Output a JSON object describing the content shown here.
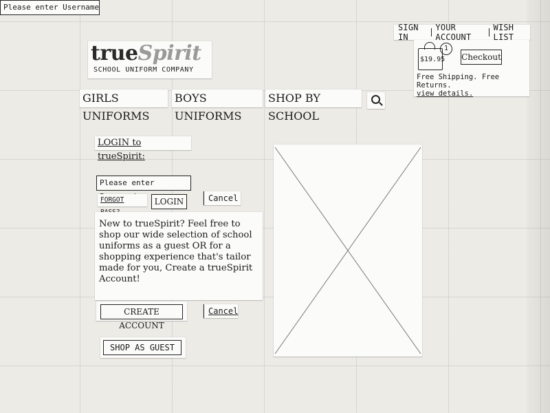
{
  "header": {
    "links": [
      "SIGN IN",
      "YOUR ACCOUNT",
      "WISH LIST"
    ],
    "cart": {
      "price": "$19.95",
      "count": "1",
      "checkout_label": "Checkout",
      "shipping_text": "Free Shipping. Free Returns.",
      "details_link": "view details."
    },
    "logo": {
      "word1": "true",
      "word2": "Spirit",
      "tagline": "SCHOOL UNIFORM COMPANY"
    }
  },
  "nav": {
    "items": [
      "GIRLS UNIFORMS",
      "BOYS UNIFORMS",
      "SHOP BY SCHOOL"
    ],
    "search_icon": "search-icon"
  },
  "login": {
    "title": "LOGIN to trueSpirit:",
    "username_placeholder": "Please enter Username",
    "password_placeholder": "Please enter Password",
    "forgot_label": "FORGOT PASS?",
    "login_label": "LOGIN",
    "cancel_label": "Cancel"
  },
  "guest_note": {
    "text": "New to trueSpirit? Feel free to shop our wide selection of school uniforms as a guest OR for a shopping experience that's tailor made for you, Create a trueSpirit Account!"
  },
  "actions": {
    "create_account_label": "CREATE ACCOUNT",
    "cancel_label": "Cancel",
    "shop_as_guest_label": "SHOP AS GUEST"
  }
}
